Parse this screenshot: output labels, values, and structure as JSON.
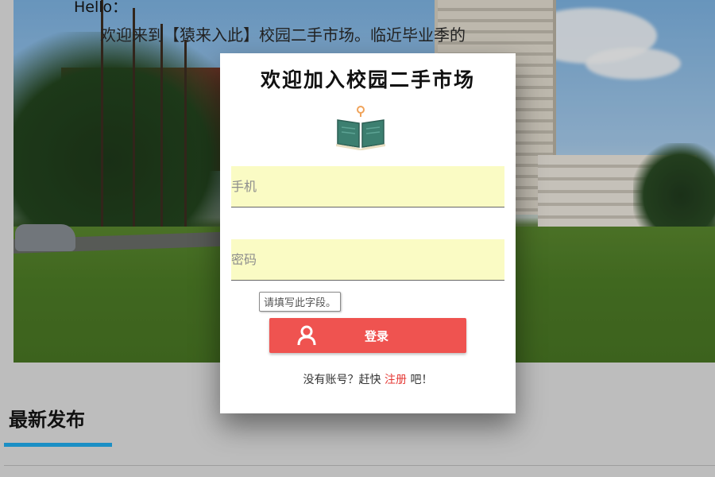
{
  "background": {
    "hello": "Hello：",
    "welcome_line": "欢迎来到【猿来入此】校园二手市场。临近毕业季的",
    "section_title": "最新发布"
  },
  "modal": {
    "title": "欢迎加入校园二手市场",
    "book_icon": "open-book-icon",
    "phone_placeholder": "手机",
    "password_placeholder": "密码",
    "tooltip": "请填写此字段。",
    "login_label": "登录",
    "login_icon": "user-icon",
    "register_prefix": "没有账号？赶快 ",
    "register_link": "注册",
    "register_suffix": " 吧！"
  },
  "colors": {
    "accent_red": "#ef5350",
    "link_red": "#e53935",
    "input_bg": "#fafbc4",
    "section_underline": "#1b8fc5"
  }
}
